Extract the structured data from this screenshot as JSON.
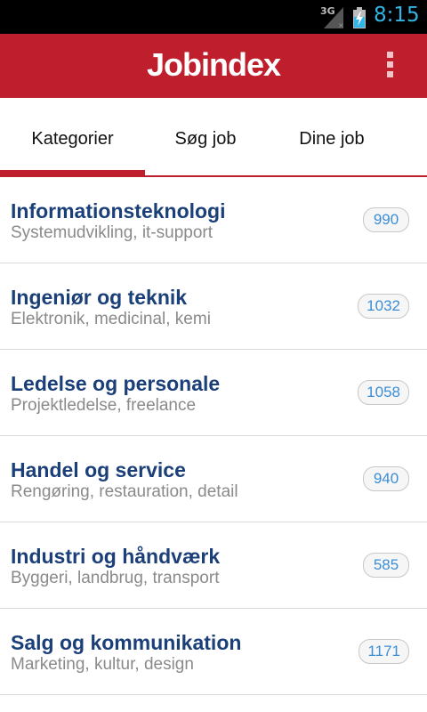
{
  "status_bar": {
    "network_label": "3G",
    "time": "8:15",
    "icons": [
      "signal-icon",
      "battery-charging-icon"
    ]
  },
  "app_bar": {
    "title": "Jobindex",
    "overflow_icon": "overflow-menu-icon"
  },
  "tabs": [
    {
      "label": "Kategorier",
      "selected": true
    },
    {
      "label": "Søg job",
      "selected": false
    },
    {
      "label": "Dine job",
      "selected": false
    }
  ],
  "categories": [
    {
      "name": "Informationsteknologi",
      "subtitle": "Systemudvikling, it-support",
      "count": "990"
    },
    {
      "name": "Ingeniør og teknik",
      "subtitle": "Elektronik, medicinal, kemi",
      "count": "1032"
    },
    {
      "name": "Ledelse og personale",
      "subtitle": "Projektledelse, freelance",
      "count": "1058"
    },
    {
      "name": "Handel og service",
      "subtitle": "Rengøring, restauration, detail",
      "count": "940"
    },
    {
      "name": "Industri og håndværk",
      "subtitle": "Byggeri, landbrug, transport",
      "count": "585"
    },
    {
      "name": "Salg og kommunikation",
      "subtitle": "Marketing, kultur, design",
      "count": "1171"
    }
  ],
  "colors": {
    "brand_red": "#bf1e2d",
    "category_title": "#1b3f78",
    "subtitle_gray": "#8a8a8a",
    "badge_text": "#3b8ed6",
    "status_accent": "#33b5e5"
  }
}
